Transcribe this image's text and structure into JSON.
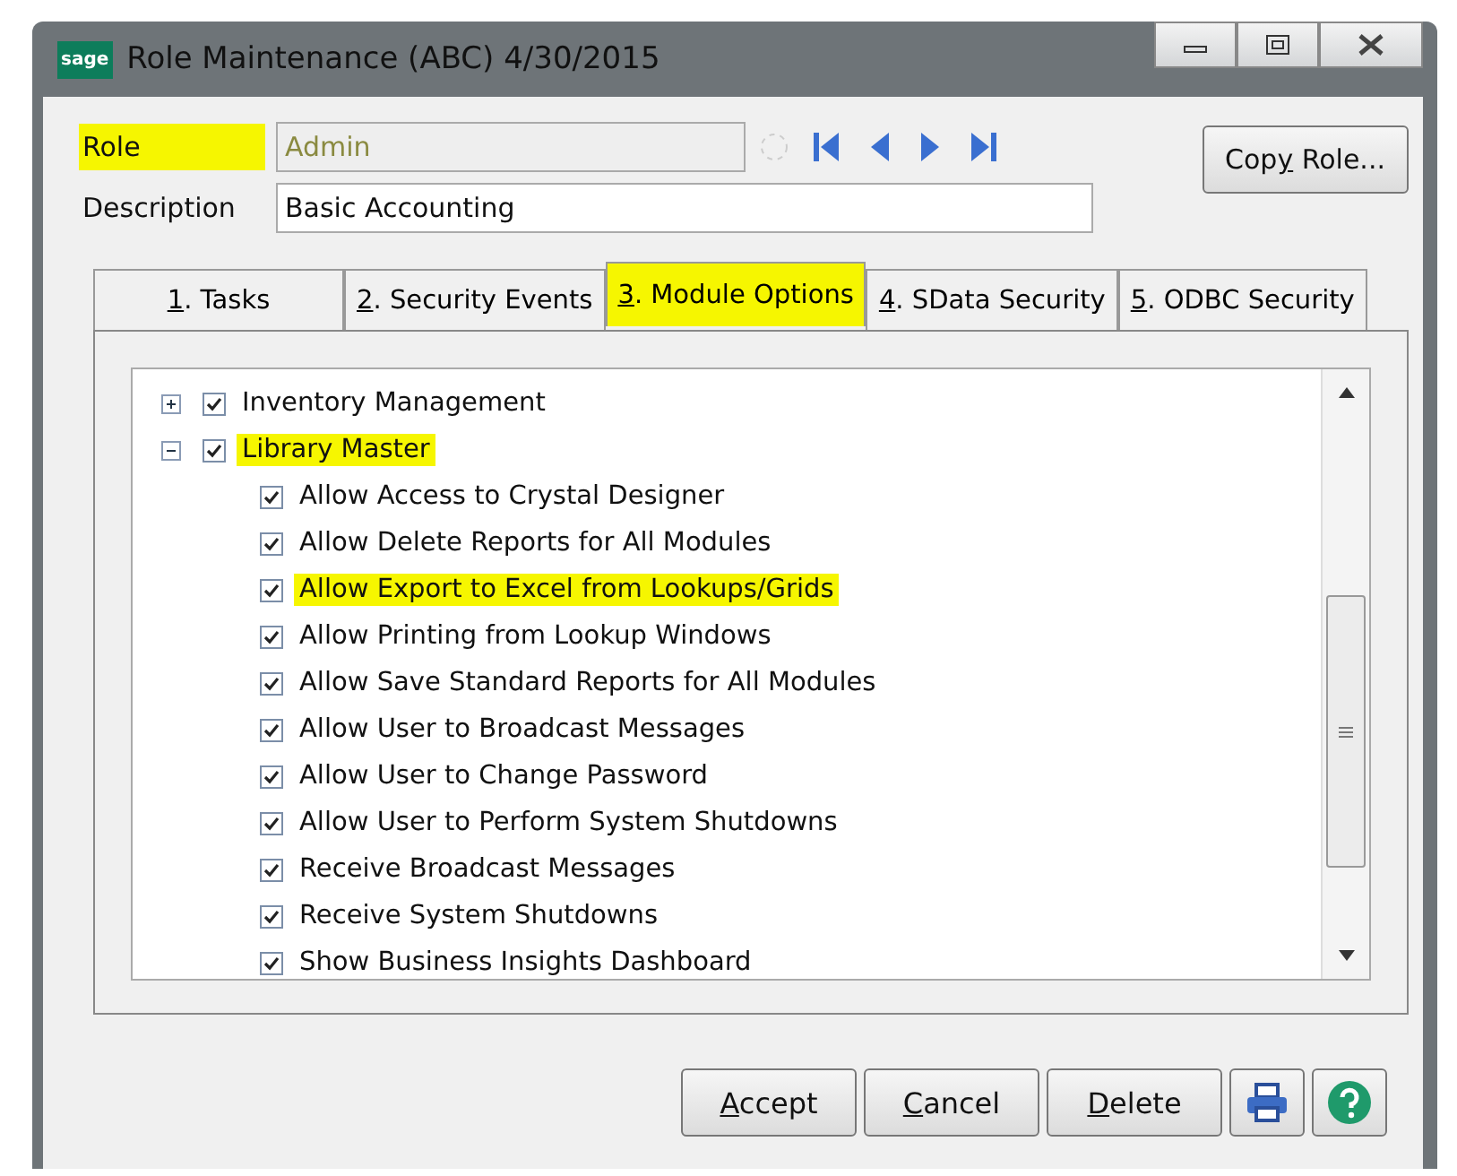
{
  "window": {
    "title": "Role Maintenance (ABC) 4/30/2015",
    "logo": "sage"
  },
  "role": {
    "label": "Role",
    "highlighted": true,
    "value": "Admin",
    "disabled": true
  },
  "description": {
    "label": "Description",
    "value": "Basic Accounting"
  },
  "copy_button": {
    "key": "y",
    "pre": "Cop",
    "post": " Role..."
  },
  "tabs": [
    {
      "key": "1",
      "rest": ". Tasks",
      "selected": false,
      "highlighted": false
    },
    {
      "key": "2",
      "rest": ". Security Events",
      "selected": false,
      "highlighted": false
    },
    {
      "key": "3",
      "rest": ". Module Options",
      "selected": true,
      "highlighted": true
    },
    {
      "key": "4",
      "rest": ". SData Security",
      "selected": false,
      "highlighted": false
    },
    {
      "key": "5",
      "rest": ". ODBC Security",
      "selected": false,
      "highlighted": false
    }
  ],
  "tree": [
    {
      "label": "Inventory Management",
      "checked": true,
      "expanded": false,
      "highlighted": false
    },
    {
      "label": "Library Master",
      "checked": true,
      "expanded": true,
      "highlighted": true,
      "children": [
        {
          "label": "Allow Access to Crystal Designer",
          "checked": true,
          "highlighted": false
        },
        {
          "label": "Allow Delete Reports for All Modules",
          "checked": true,
          "highlighted": false
        },
        {
          "label": "Allow Export to Excel from Lookups/Grids",
          "checked": true,
          "highlighted": true
        },
        {
          "label": "Allow Printing from Lookup Windows",
          "checked": true,
          "highlighted": false
        },
        {
          "label": "Allow Save Standard Reports for All Modules",
          "checked": true,
          "highlighted": false
        },
        {
          "label": "Allow User to Broadcast Messages",
          "checked": true,
          "highlighted": false
        },
        {
          "label": "Allow User to Change Password",
          "checked": true,
          "highlighted": false
        },
        {
          "label": "Allow User to Perform System Shutdowns",
          "checked": true,
          "highlighted": false
        },
        {
          "label": "Receive Broadcast Messages",
          "checked": true,
          "highlighted": false
        },
        {
          "label": "Receive System Shutdowns",
          "checked": true,
          "highlighted": false
        },
        {
          "label": "Show Business Insights Dashboard",
          "checked": true,
          "highlighted": false
        }
      ]
    }
  ],
  "buttons": [
    {
      "key": "A",
      "rest": "ccept"
    },
    {
      "key": "C",
      "rest": "ancel"
    },
    {
      "key": "D",
      "rest": "elete"
    }
  ]
}
